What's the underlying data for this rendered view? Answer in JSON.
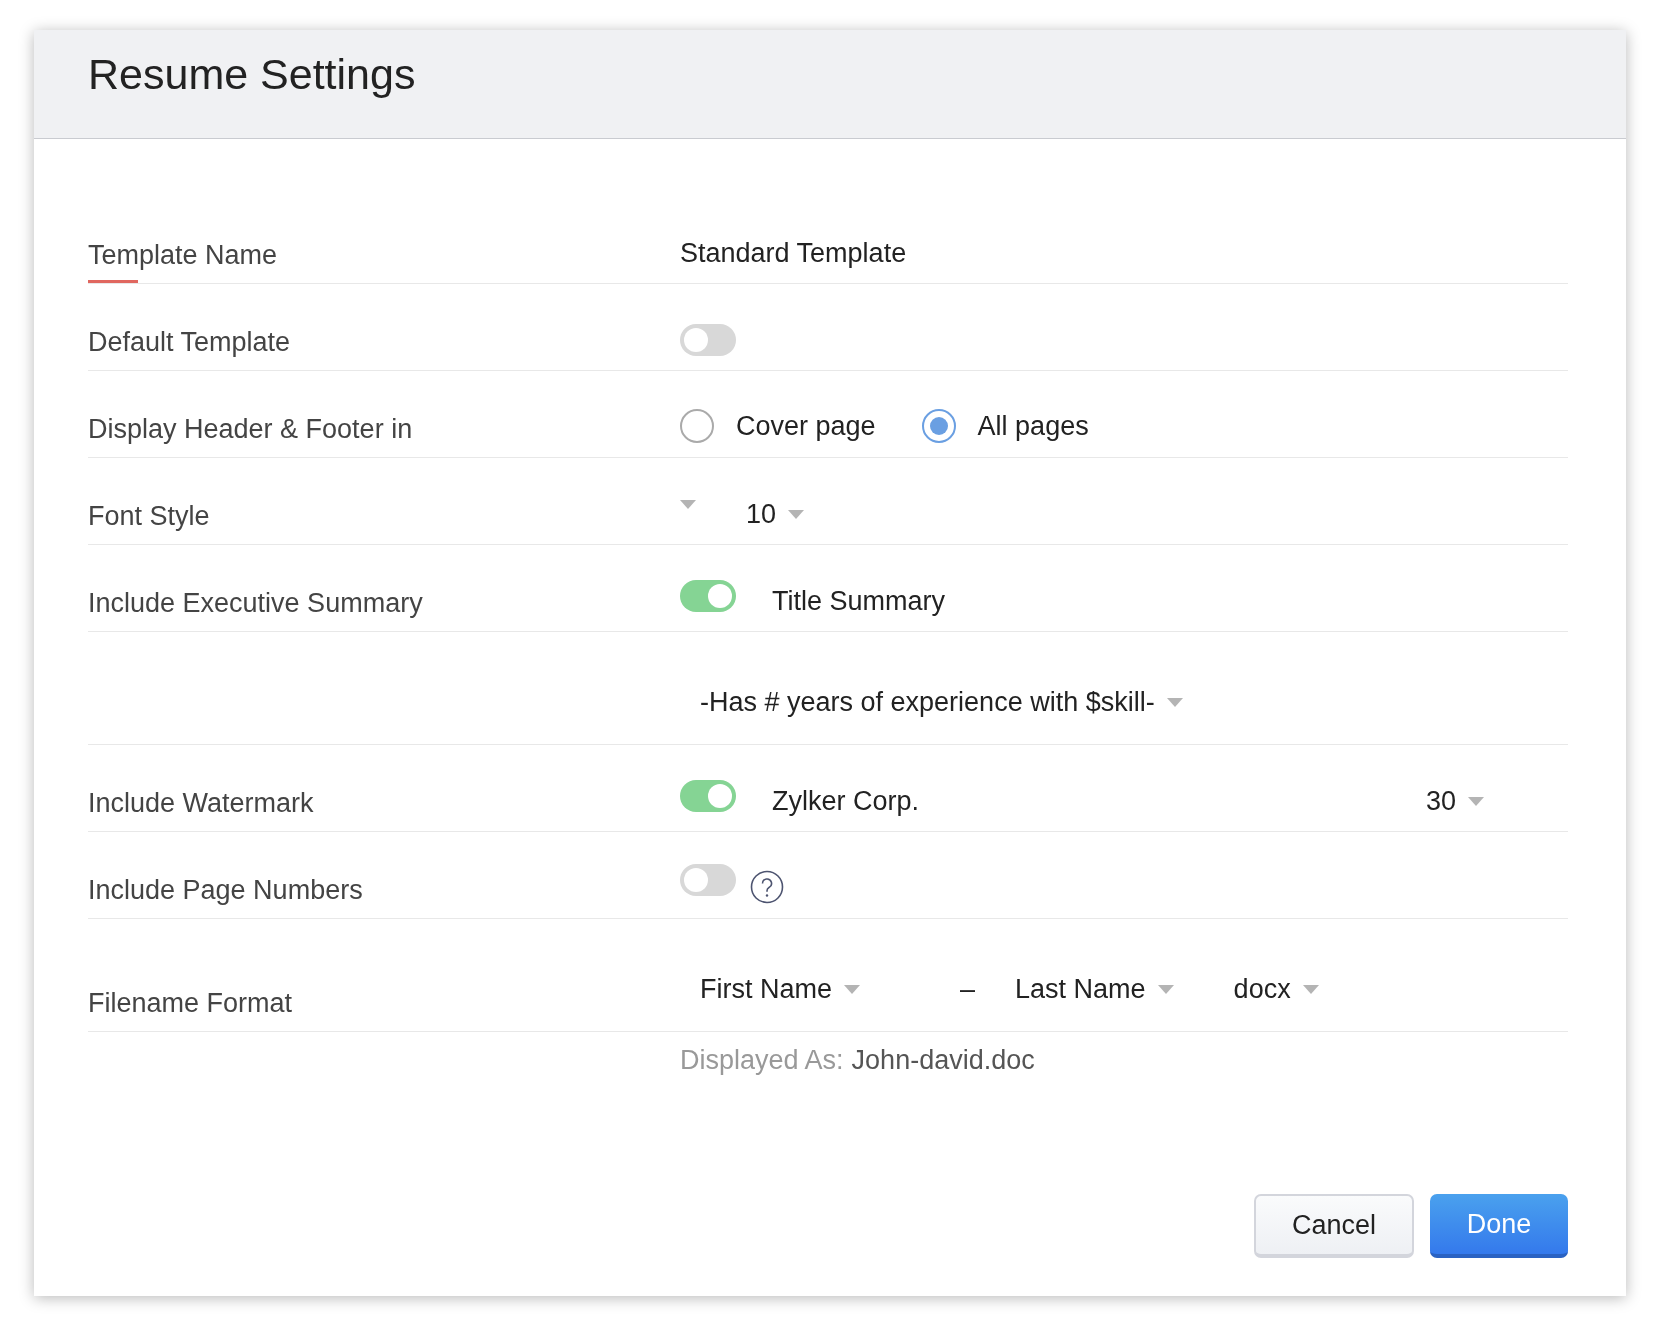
{
  "dialog": {
    "title": "Resume Settings"
  },
  "fields": [
    {
      "kind": "text",
      "label": "Template Name",
      "focused": true,
      "value": "Standard Template"
    },
    {
      "kind": "toggle",
      "label": "Default Template",
      "on": false
    },
    {
      "kind": "radio",
      "label": "Display Header & Footer in",
      "options": [
        {
          "label": "Cover page",
          "selected": false
        },
        {
          "label": "All pages",
          "selected": true
        }
      ]
    },
    {
      "kind": "font",
      "label": "Font Style",
      "font_size": "10"
    },
    {
      "kind": "toggle",
      "label": "Include Executive Summary",
      "on": true,
      "text": "Title Summary"
    },
    {
      "kind": "dropdown",
      "value": "-Has # years of experience with $skill-"
    },
    {
      "kind": "toggle",
      "label": "Include Watermark",
      "on": true,
      "text": "Zylker Corp.",
      "dropdown": "30"
    },
    {
      "kind": "toggle",
      "label": "Include Page Numbers",
      "on": false,
      "help": true
    },
    {
      "kind": "filename",
      "label": "Filename Format",
      "parts": [
        {
          "kind": "dropdown",
          "value": "First Name"
        },
        {
          "kind": "separator",
          "value": "–"
        },
        {
          "kind": "dropdown",
          "value": "Last Name"
        },
        {
          "kind": "dropdown",
          "value": "docx"
        }
      ]
    },
    {
      "kind": "note",
      "caption": "Displayed As:",
      "value": "John-david.doc"
    }
  ],
  "buttons": [
    {
      "label": "Cancel",
      "kind": "secondary"
    },
    {
      "label": "Done",
      "kind": "primary"
    }
  ]
}
